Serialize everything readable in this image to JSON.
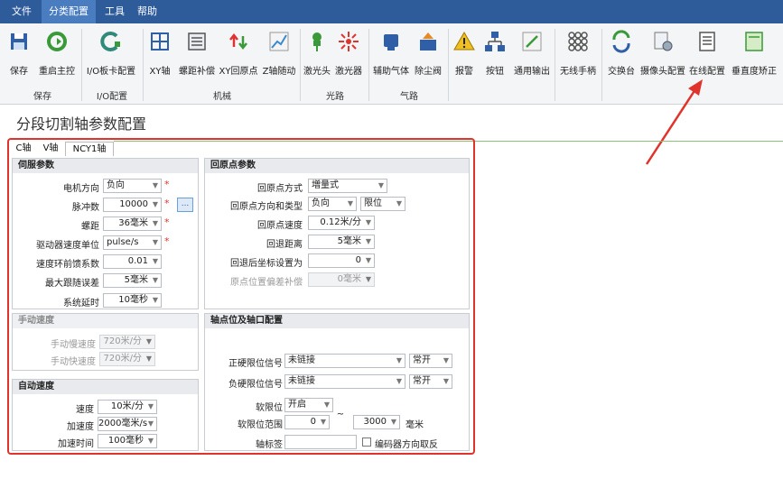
{
  "menu": {
    "items": [
      "文件",
      "分类配置",
      "工具",
      "帮助"
    ]
  },
  "ribbon": {
    "buttons": [
      "保存",
      "重启主控",
      "I/O板卡配置",
      "XY轴",
      "螺距补偿",
      "XY回原点",
      "Z轴随动",
      "激光头",
      "激光器",
      "辅助气体",
      "除尘阀",
      "报警",
      "按钮",
      "通用输出",
      "无线手柄",
      "交换台",
      "摄像头配置",
      "在线配置",
      "垂直度矫正"
    ],
    "groups": [
      "保存",
      "I/O配置",
      "机械",
      "光路",
      "气路"
    ]
  },
  "page": {
    "title": "分段切割轴参数配置"
  },
  "tabs": [
    "C轴",
    "V轴",
    "NCY1轴"
  ],
  "servo": {
    "title": "伺服参数",
    "labels": [
      "电机方向",
      "脉冲数",
      "螺距",
      "驱动器速度单位",
      "速度环前馈系数",
      "最大跟随误差",
      "系统延时"
    ],
    "values": [
      "负向",
      "10000",
      "36毫米",
      "pulse/s",
      "0.01",
      "5毫米",
      "10毫秒"
    ]
  },
  "home": {
    "title": "回原点参数",
    "labels": [
      "回原点方式",
      "回原点方向和类型",
      "回原点速度",
      "回退距离",
      "回退后坐标设置为",
      "原点位置偏差补偿"
    ],
    "mode": "増量式",
    "direction": "负向",
    "type": "限位",
    "speed": "0.12米/分",
    "retreat": "5毫米",
    "coord": "0",
    "offset": "0毫米"
  },
  "manual": {
    "title": "手动速度",
    "labels": [
      "手动慢速度",
      "手动快速度"
    ],
    "values": [
      "720米/分",
      "720米/分"
    ]
  },
  "auto": {
    "title": "自动速度",
    "labels": [
      "速度",
      "加速度",
      "加速时间"
    ],
    "values": [
      "10米/分",
      "2000毫米/s",
      "100毫秒"
    ]
  },
  "limit": {
    "title": "轴点位及轴口配置",
    "pos_label": "正硬限位信号",
    "pos_value": "未链接",
    "pos_mode": "常开",
    "neg_label": "负硬限位信号",
    "neg_value": "未链接",
    "neg_mode": "常开",
    "soft_label": "软限位",
    "soft_value": "开启",
    "range_label": "软限位范围",
    "range_min": "0",
    "range_sep": "~",
    "range_max": "3000",
    "range_unit": "毫米",
    "axis_label": "轴标签",
    "axis_value": "",
    "encoder_label": "编码器方向取反"
  },
  "colors": {
    "menubar": "#2e5b9a",
    "highlight": "#e0332b",
    "accent_line": "#8cc17a"
  }
}
